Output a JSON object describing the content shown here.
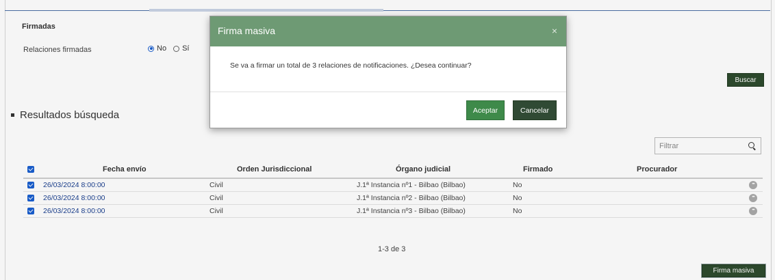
{
  "filters": {
    "title": "Firmadas",
    "relaciones_label": "Relaciones firmadas",
    "radio_no": "No",
    "radio_si": "Sí",
    "search_button": "Buscar"
  },
  "results": {
    "title": "Resultados búsqueda",
    "filter_placeholder": "Filtrar",
    "columns": [
      "Fecha envío",
      "Orden Jurisdiccional",
      "Órgano judicial",
      "Firmado",
      "Procurador"
    ],
    "rows": [
      {
        "fecha": "26/03/2024 8:00:00",
        "orden": "Civil",
        "organo": "J.1ª Instancia nº1 - Bilbao (Bilbao)",
        "firmado": "No",
        "procurador": ""
      },
      {
        "fecha": "26/03/2024 8:00:00",
        "orden": "Civil",
        "organo": "J.1ª Instancia nº2 - Bilbao (Bilbao)",
        "firmado": "No",
        "procurador": ""
      },
      {
        "fecha": "26/03/2024 8:00:00",
        "orden": "Civil",
        "organo": "J.1ª Instancia nº3 - Bilbao (Bilbao)",
        "firmado": "No",
        "procurador": ""
      }
    ],
    "pagination": "1-3 de 3",
    "bulk_sign_button": "Firma masiva"
  },
  "modal": {
    "title": "Firma masiva",
    "close_symbol": "×",
    "message": "Se va a firmar un total de 3 relaciones de notificaciones. ¿Desea continuar?",
    "accept_button": "Aceptar",
    "cancel_button": "Cancelar"
  },
  "colors": {
    "modal_header": "#6e9a74",
    "accept": "#3e8a4a",
    "dark_button": "#2e4b2e",
    "checkbox": "#1a5fd0"
  }
}
